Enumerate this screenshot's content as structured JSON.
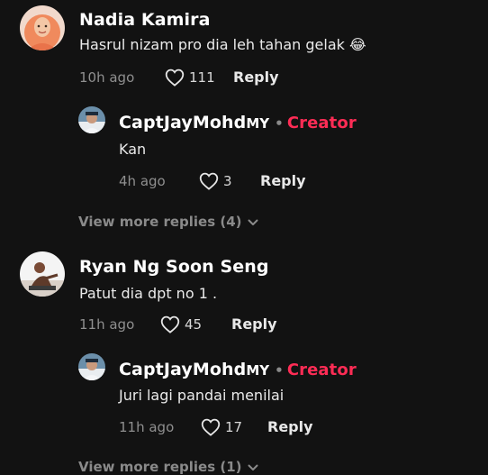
{
  "comments": [
    {
      "name": "Nadia Kamira",
      "text": "Hasrul nizam pro dia leh tahan gelak 😂",
      "time": "10h ago",
      "likes": "111",
      "reply_label": "Reply",
      "reply": {
        "name": "CaptJayMohd",
        "name_suffix": "MY",
        "separator": "•",
        "badge": "Creator",
        "text": "Kan",
        "time": "4h ago",
        "likes": "3",
        "reply_label": "Reply"
      },
      "view_more": "View more replies (4)"
    },
    {
      "name": "Ryan Ng Soon Seng",
      "text": "Patut dia dpt no 1 .",
      "time": "11h ago",
      "likes": "45",
      "reply_label": "Reply",
      "reply": {
        "name": "CaptJayMohd",
        "name_suffix": "MY",
        "separator": "•",
        "badge": "Creator",
        "text": "Juri lagi pandai menilai",
        "time": "11h ago",
        "likes": "17",
        "reply_label": "Reply"
      },
      "view_more": "View more replies (1)"
    }
  ],
  "colors": {
    "background": "#121212",
    "creator_badge": "#fe2c55",
    "muted_text": "#8f8f8f"
  },
  "icons": {
    "like": "heart-outline-icon",
    "expand": "chevron-down-icon"
  }
}
